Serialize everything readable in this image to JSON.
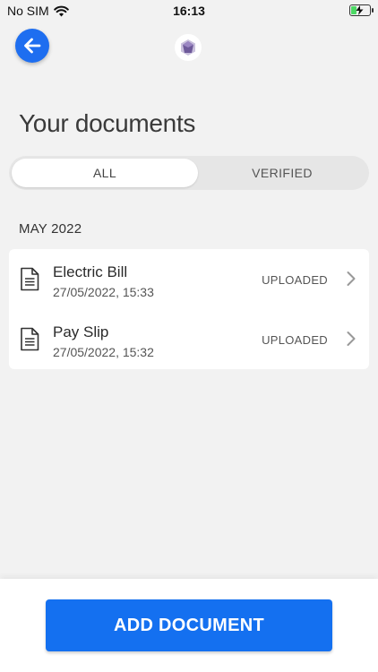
{
  "status_bar": {
    "carrier": "No SIM",
    "time": "16:13",
    "battery_level": 0.3,
    "charging": true
  },
  "header": {
    "back_icon": "arrow-left-icon",
    "logo_icon": "hexagon-gem-logo"
  },
  "page": {
    "title": "Your documents"
  },
  "tabs": [
    {
      "label": "ALL",
      "active": true
    },
    {
      "label": "VERIFIED",
      "active": false
    }
  ],
  "sections": [
    {
      "header": "MAY 2022",
      "documents": [
        {
          "title": "Electric Bill",
          "date": "27/05/2022, 15:33",
          "status": "UPLOADED",
          "icon": "document-icon"
        },
        {
          "title": "Pay Slip",
          "date": "27/05/2022, 15:32",
          "status": "UPLOADED",
          "icon": "document-icon"
        }
      ]
    }
  ],
  "footer": {
    "add_button_label": "ADD DOCUMENT"
  },
  "colors": {
    "primary": "#1470f0",
    "background": "#f2f2f2",
    "card": "#ffffff",
    "battery": "#4cd964"
  }
}
